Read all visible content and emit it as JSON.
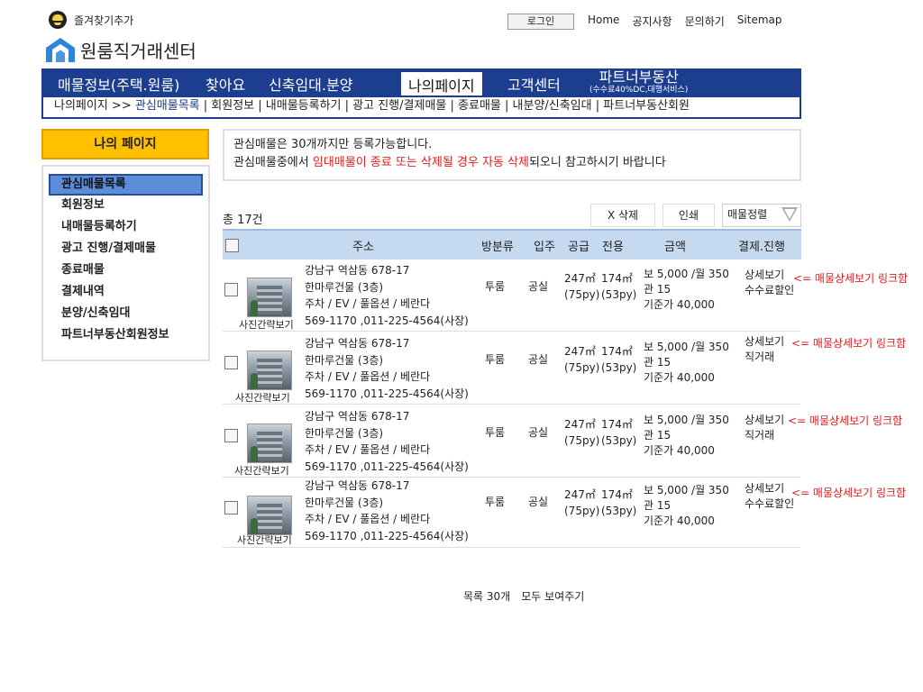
{
  "top": {
    "favorite_label": "즐겨찾기추가",
    "login_label": "로그인",
    "links": [
      "Home",
      "공지사항",
      "문의하기",
      "Sitemap"
    ]
  },
  "logo": {
    "text": "원룸직거래센터"
  },
  "nav": {
    "items": [
      "매물정보(주택.원룸)",
      "찾아요",
      "신축임대.분양",
      "나의페이지",
      "고객센터"
    ],
    "active": "나의페이지",
    "partner_title": "파트너부동산",
    "partner_sub": "(수수료40%DC,대행서비스)"
  },
  "subnav": {
    "prefix": "나의페이지 >> ",
    "current": "관심매물목록",
    "items": [
      "회원정보",
      "내매물등록하기",
      "광고 진행/결제매물",
      "종료매물",
      "내분양/신축임대",
      "파트너부동산회원"
    ]
  },
  "sidebar": {
    "title": "나의 페이지",
    "items": [
      "관심매물목록",
      "회원정보",
      "내매물등록하기",
      "광고 진행/결제매물",
      "종료매물",
      "결제내역",
      "분양/신축임대",
      "파트너부동산회원정보"
    ]
  },
  "notice": {
    "line1": "관심매물은 30개까지만 등록가능합니다.",
    "line2_pre": "관심매물중에서 ",
    "line2_red": "임대매물이 종료 또는 삭제될 경우 자동 삭제",
    "line2_post": "되오니 참고하시기 바랍니다"
  },
  "toolbar": {
    "total": "총 17건",
    "delete_label": "X 삭제",
    "print_label": "인쇄",
    "sort_label": "매물정렬"
  },
  "table": {
    "headers": [
      "주소",
      "방분류",
      "입주",
      "공급",
      "전용",
      "금액",
      "결제.진행"
    ],
    "rows": [
      {
        "photo_label": "사진간략보기",
        "addr1": "강남구 역삼동 678-17",
        "addr2": " 한마루건물    (3층)",
        "addr3": "주차 / EV / 풀옵션 / 베란다",
        "addr4": "569-1170 ,011-225-4564(사장)",
        "type": "투룸",
        "move_in": "공실",
        "supply": "247㎡",
        "supply_py": "(75py)",
        "exclusive": "174㎡",
        "exclusive_py": "(53py)",
        "price1": "보 5,000 /월 350",
        "price2": "관 15",
        "price3": "기준가 40,000",
        "detail": "상세보기",
        "status": "수수료할인",
        "note": "<= 매물상세보기 링크함"
      },
      {
        "photo_label": "사진간략보기",
        "addr1": "강남구 역삼동 678-17",
        "addr2": " 한마루건물    (3층)",
        "addr3": "주차 / EV / 풀옵션 / 베란다",
        "addr4": "569-1170 ,011-225-4564(사장)",
        "type": "투룸",
        "move_in": "공실",
        "supply": "247㎡",
        "supply_py": "(75py)",
        "exclusive": "174㎡",
        "exclusive_py": "(53py)",
        "price1": "보 5,000 /월 350",
        "price2": "관 15",
        "price3": "기준가 40,000",
        "detail": "상세보기",
        "status": "직거래",
        "note": "<= 매물상세보기 링크함"
      },
      {
        "photo_label": "사진간략보기",
        "addr1": "강남구 역삼동 678-17",
        "addr2": " 한마루건물    (3층)",
        "addr3": "주차 / EV / 풀옵션 / 베란다",
        "addr4": "569-1170 ,011-225-4564(사장)",
        "type": "투룸",
        "move_in": "공실",
        "supply": "247㎡",
        "supply_py": "(75py)",
        "exclusive": "174㎡",
        "exclusive_py": "(53py)",
        "price1": "보 5,000 /월 350",
        "price2": "관 15",
        "price3": "기준가 40,000",
        "detail": "상세보기",
        "status": "직거래",
        "note": "<= 매물상세보기 링크함"
      },
      {
        "photo_label": "사진간략보기",
        "addr1": "강남구 역삼동 678-17",
        "addr2": " 한마루건물    (3층)",
        "addr3": "주차 / EV / 풀옵션 / 베란다",
        "addr4": "569-1170 ,011-225-4564(사장)",
        "type": "투룸",
        "move_in": "공실",
        "supply": "247㎡",
        "supply_py": "(75py)",
        "exclusive": "174㎡",
        "exclusive_py": "(53py)",
        "price1": "보 5,000 /월 350",
        "price2": "관 15",
        "price3": "기준가 40,000",
        "detail": "상세보기",
        "status": "수수료할인",
        "note": "<= 매물상세보기 링크함"
      }
    ]
  },
  "footer": {
    "list_label": "목록  30개",
    "show_all_label": "모두 보여주기"
  },
  "colors": {
    "nav_bg": "#1d3d8f",
    "sidebar_title_bg": "#ffc000",
    "table_header_bg": "#c5d9f1",
    "highlight_red": "#e02020"
  }
}
